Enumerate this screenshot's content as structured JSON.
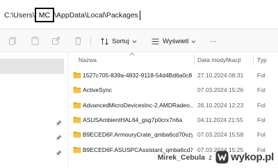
{
  "address_bar": {
    "path_before": "C:\\Users\\",
    "masked_segment": "MC",
    "path_after": "\\AppData\\Local\\Packages"
  },
  "toolbar": {
    "sort_label": "Sortuj",
    "view_label": "Wyświetl",
    "more_label": "···"
  },
  "columns": {
    "name": "Nazwa",
    "date": "Data modyfikacji",
    "type": "Typ"
  },
  "files": [
    {
      "name": "1527c705-839a-4832-9118-54d4Bd6a0c8...",
      "date": "27.10.2024 08:31",
      "type": "Fol"
    },
    {
      "name": "ActiveSync",
      "date": "07.03.2024 15:26",
      "type": "Fol"
    },
    {
      "name": "AdvancedMicroDevicesInc-2.AMDRadeo...",
      "date": "26.10.2024 12:23",
      "type": "Fol"
    },
    {
      "name": "ASUSAmbientHAL64_gsg7p0crx7n6a",
      "date": "04.11.2024 21:55",
      "type": "Fol"
    },
    {
      "name": "B9ECED6F.ArmouryCrate_qmba6cd70vzyy",
      "date": "07.03.2024 15:58",
      "type": "Fol"
    },
    {
      "name": "B9ECED6F.ASUSPCAssistant_qmba6cd70...",
      "date": "07.03.2024 15:25",
      "type": "Fol"
    }
  ],
  "watermark": {
    "user": "Mirek_Cebula",
    "z": "z",
    "site": "wykop.pl"
  },
  "colors": {
    "folder": "#f3c343",
    "folder_dark": "#e0a92a",
    "watermark": "#3a3a3a"
  }
}
